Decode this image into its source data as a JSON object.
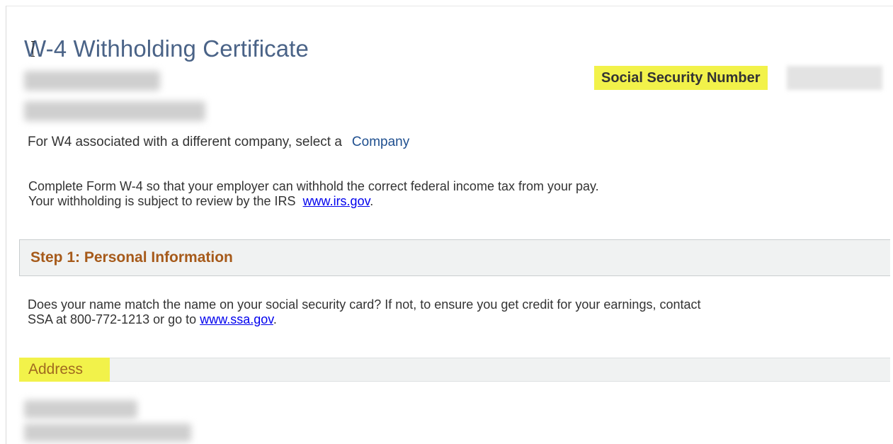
{
  "header": {
    "title": "W-4 Withholding Certificate",
    "ssn_label": "Social Security Number"
  },
  "company": {
    "prompt": "For W4 associated with a different company, select a",
    "link_label": "Company"
  },
  "intro": {
    "line1": "Complete Form W-4 so that your employer can withhold the correct federal income tax from your pay.",
    "line2": "Your withholding is subject to review by the IRS",
    "link": "www.irs.gov",
    "suffix": "."
  },
  "step1": {
    "title": "Step 1: Personal Information",
    "question_line1": "Does your name match the name on your social security card? If not, to ensure you get credit for your earnings, contact",
    "question_line2": "SSA at 800-772-1213 or go to",
    "link": "www.ssa.gov",
    "suffix": "."
  },
  "address": {
    "label": "Address"
  },
  "colors": {
    "title": "#4a6387",
    "highlight": "#f2f24a",
    "section_header_text": "#a65a1a",
    "link": "#0000ee",
    "company_link": "#1f4f8f"
  }
}
